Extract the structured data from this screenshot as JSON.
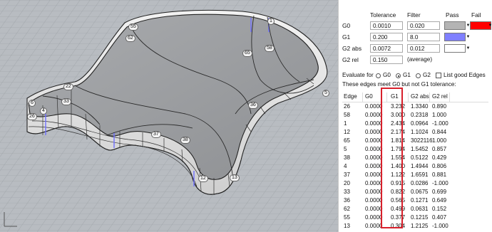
{
  "viewport": {
    "labels": [
      "55",
      "62",
      "1",
      "65",
      "58",
      "22",
      "33",
      "6",
      "26",
      "4",
      "36",
      "37",
      "38",
      "12",
      "13",
      "5"
    ]
  },
  "tolerance_panel": {
    "headers": {
      "tolerance": "Tolerance",
      "filter": "Filter",
      "pass": "Pass",
      "fail": "Fail"
    },
    "rows": [
      {
        "label": "G0",
        "tolerance": "0.0010",
        "filter": "0.020",
        "pass_color": "#b4b4b4"
      },
      {
        "label": "G1",
        "tolerance": "0.200",
        "filter": "8.0",
        "pass_color": "#8080ff"
      },
      {
        "label": "G2 abs",
        "tolerance": "0.0072",
        "filter": "0.012",
        "pass_color": "#ffffff"
      },
      {
        "label": "G2 rel",
        "tolerance": "0.150",
        "note": "(average)"
      }
    ],
    "fail_color": "#ff0000"
  },
  "evaluate": {
    "label": "Evaluate for",
    "options": [
      "G0",
      "G1",
      "G2"
    ],
    "selected": "G1",
    "list_good_label": "List good Edges",
    "list_good_checked": false,
    "message": "These edges meet G0 but not G1 tolerance:"
  },
  "table": {
    "columns": [
      "Edge",
      "G0",
      "G1",
      "G2 abs",
      "G2 rel"
    ],
    "rows": [
      [
        "26",
        "0.0000",
        "3.232",
        "1.3340",
        "0.890"
      ],
      [
        "58",
        "0.0000",
        "3.000",
        "0.2318",
        "1.000"
      ],
      [
        "1",
        "0.0000",
        "2.434",
        "0.0964",
        "-1.000"
      ],
      [
        "12",
        "0.0000",
        "2.174",
        "1.1024",
        "0.844"
      ],
      [
        "65",
        "0.0000",
        "1.814",
        "3022116",
        "1.000"
      ],
      [
        "5",
        "0.0000",
        "1.794",
        "1.5452",
        "0.857"
      ],
      [
        "38",
        "0.0000",
        "1.554",
        "0.5122",
        "0.429"
      ],
      [
        "4",
        "0.0000",
        "1.400",
        "1.4944",
        "0.806"
      ],
      [
        "37",
        "0.0000",
        "1.122",
        "1.6591",
        "0.881"
      ],
      [
        "20",
        "0.0000",
        "0.915",
        "0.0286",
        "-1.000"
      ],
      [
        "33",
        "0.0000",
        "0.822",
        "0.0675",
        "0.699"
      ],
      [
        "36",
        "0.0000",
        "0.565",
        "0.1271",
        "0.649"
      ],
      [
        "62",
        "0.0000",
        "0.499",
        "0.0631",
        "0.152"
      ],
      [
        "55",
        "0.0000",
        "0.377",
        "0.1215",
        "0.407"
      ],
      [
        "13",
        "0.0000",
        "0.304",
        "1.2125",
        "-1.000"
      ]
    ]
  }
}
